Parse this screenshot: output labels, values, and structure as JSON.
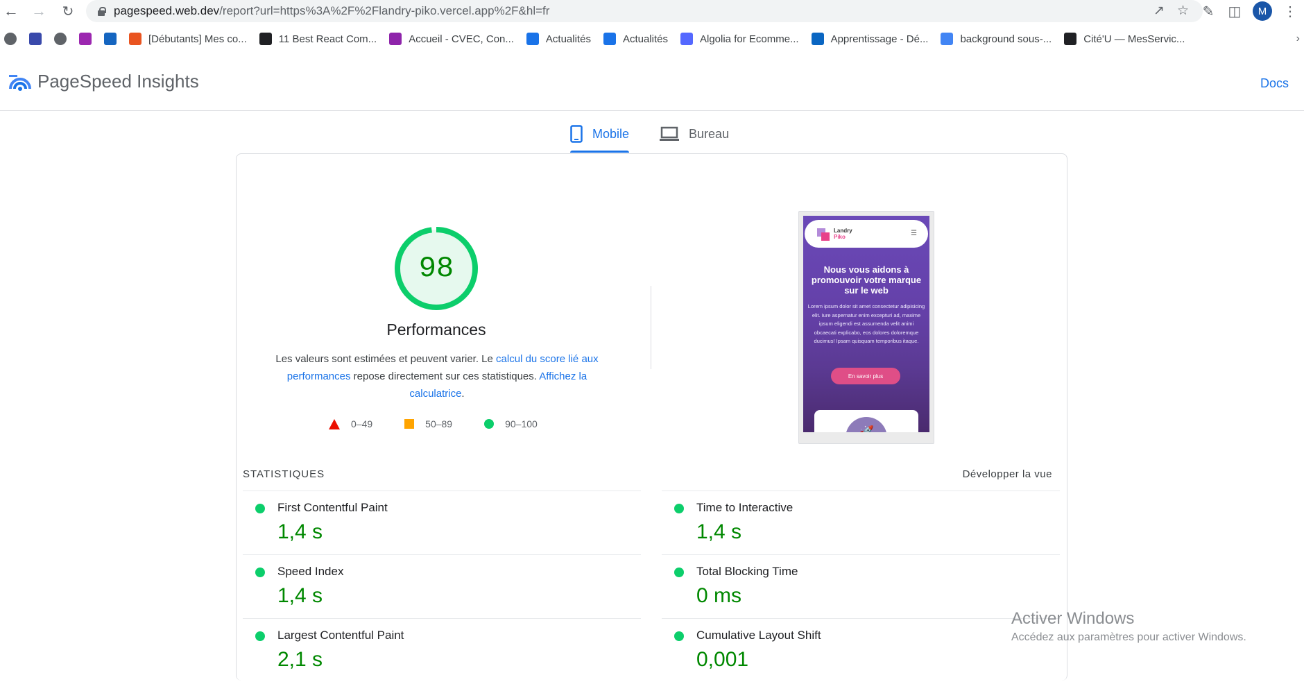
{
  "browser": {
    "url_host": "pagespeed.web.dev",
    "url_path": "/report?url=https%3A%2F%2Flandry-piko.vercel.app%2F&hl=fr",
    "avatar_letter": "M"
  },
  "bookmarks": [
    {
      "label": "",
      "icon": "globe-icon",
      "color": "#5f6368"
    },
    {
      "label": "",
      "icon": "gauge-icon",
      "color": "#3949ab"
    },
    {
      "label": "",
      "icon": "globe-icon",
      "color": "#5f6368"
    },
    {
      "label": "",
      "icon": "w3schools-icon",
      "color": "#9c27b0"
    },
    {
      "label": "",
      "icon": "bug-icon",
      "color": "#1565c0"
    },
    {
      "label": "[Débutants] Mes co...",
      "icon": "ubuntu-icon",
      "color": "#e95420"
    },
    {
      "label": "11 Best React Com...",
      "icon": "x-icon",
      "color": "#202124"
    },
    {
      "label": "Accueil - CVEC, Con...",
      "icon": "cvec-icon",
      "color": "#8e24aa"
    },
    {
      "label": "Actualités",
      "icon": "news-icon",
      "color": "#1a73e8"
    },
    {
      "label": "Actualités",
      "icon": "news-icon",
      "color": "#1a73e8"
    },
    {
      "label": "Algolia for Ecomme...",
      "icon": "algolia-icon",
      "color": "#5468ff"
    },
    {
      "label": "Apprentissage - Dé...",
      "icon": "linkedin-icon",
      "color": "#0a66c2"
    },
    {
      "label": "background sous-...",
      "icon": "google-icon",
      "color": "#4285f4"
    },
    {
      "label": "Cité'U — MesServic...",
      "icon": "cite-u-icon",
      "color": "#202124"
    }
  ],
  "header": {
    "title": "PageSpeed Insights",
    "docs_label": "Docs"
  },
  "tabs": [
    {
      "label": "Mobile",
      "active": true
    },
    {
      "label": "Bureau",
      "active": false
    }
  ],
  "score": {
    "value": "98",
    "fraction": 0.98,
    "color": "#0cce6b",
    "category": "Performances",
    "desc_1": "Les valeurs sont estimées et peuvent varier. Le ",
    "desc_link_1": "calcul du score lié aux performances",
    "desc_2": " repose directement sur ces statistiques. ",
    "desc_link_2": "Affichez la calculatrice",
    "desc_3": "."
  },
  "legend": [
    {
      "range": "0–49",
      "shape": "triangle",
      "color": "#eb0f00"
    },
    {
      "range": "50–89",
      "shape": "square",
      "color": "#ffa400"
    },
    {
      "range": "90–100",
      "shape": "circle",
      "color": "#0cce6b"
    }
  ],
  "preview": {
    "brand_line_1": "Landry",
    "brand_line_2": "Piko",
    "headline": "Nous vous aidons à promouvoir votre marque sur le web",
    "paragraph": "Lorem ipsum dolor sit amet consectetur adipisicing elit. Iure aspernatur enim excepturi ad, maxime ipsum eligendi est assumenda velit animi obcaecati explicabo, eos dolores doloremque ducimus! Ipsam quisquam temporibus itaque.",
    "button_label": "En savoir plus"
  },
  "stats": {
    "section_label": "STATISTIQUES",
    "expand_label": "Développer la vue",
    "metrics": [
      {
        "name": "First Contentful Paint",
        "value": "1,4 s"
      },
      {
        "name": "Time to Interactive",
        "value": "1,4 s"
      },
      {
        "name": "Speed Index",
        "value": "1,4 s"
      },
      {
        "name": "Total Blocking Time",
        "value": "0 ms"
      },
      {
        "name": "Largest Contentful Paint",
        "value": "2,1 s"
      },
      {
        "name": "Cumulative Layout Shift",
        "value": "0,001"
      }
    ]
  },
  "watermark": {
    "title": "Activer Windows",
    "subtitle": "Accédez aux paramètres pour activer Windows."
  }
}
